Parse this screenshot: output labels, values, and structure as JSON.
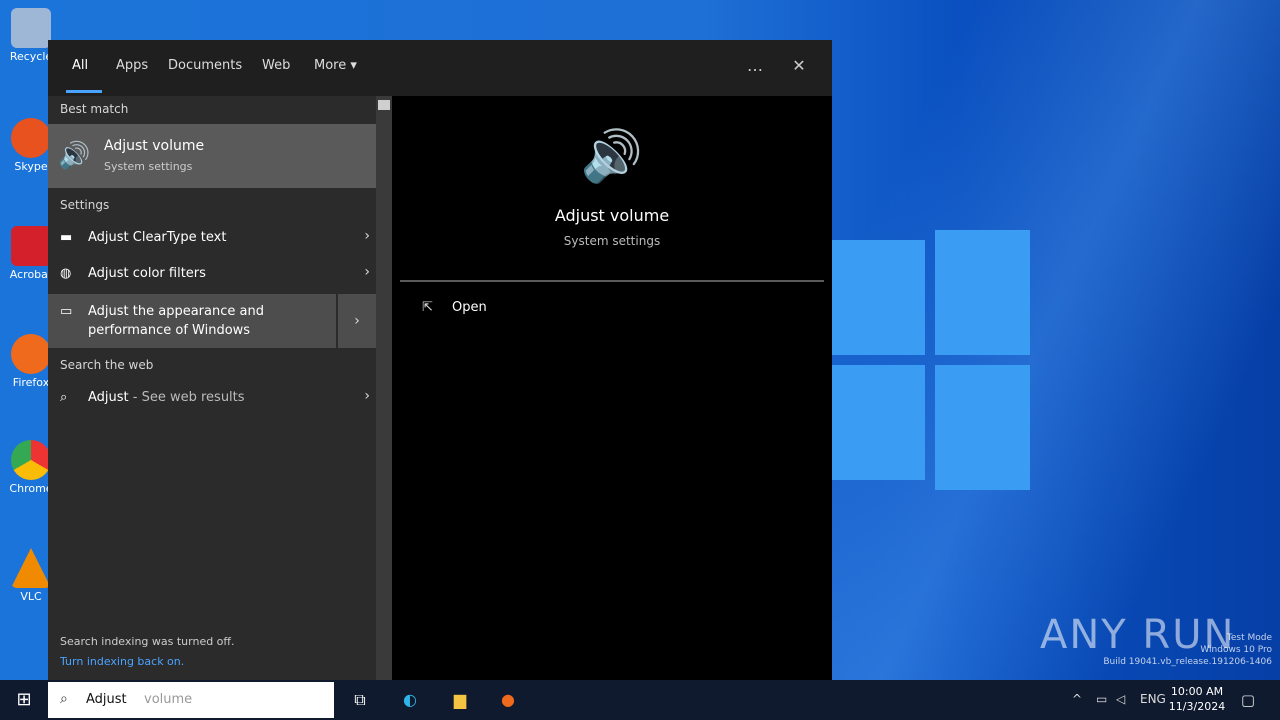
{
  "desktop": {
    "icons": [
      {
        "label": "Recycle",
        "icon": "recycle-bin-icon"
      },
      {
        "label": "Skype",
        "icon": "skype-icon"
      },
      {
        "label": "Acrobat",
        "icon": "acrobat-icon"
      },
      {
        "label": "Firefox",
        "icon": "firefox-icon"
      },
      {
        "label": "Chrome",
        "icon": "chrome-icon"
      },
      {
        "label": "VLC",
        "icon": "vlc-icon"
      }
    ],
    "watermark": "ANY RUN",
    "watermark_sub": "Test Mode\nWindows 10 Pro\nBuild 19041.vb_release.191206-1406"
  },
  "search_panel": {
    "tabs": [
      "All",
      "Apps",
      "Documents",
      "Web",
      "More ▾"
    ],
    "active_tab": "All",
    "window_controls": {
      "more": "…",
      "close": "✕"
    },
    "left": {
      "best_match_heading": "Best match",
      "best_match": {
        "title": "Adjust volume",
        "subtitle": "System settings",
        "icon": "speaker-icon"
      },
      "settings_heading": "Settings",
      "settings_items": [
        {
          "label": "Adjust ClearType text",
          "icon": "cleartype-icon"
        },
        {
          "label": "Adjust color filters",
          "icon": "color-filter-icon"
        },
        {
          "label": "Adjust the appearance and performance of Windows",
          "icon": "monitor-icon"
        }
      ],
      "web_heading": "Search the web",
      "web_item": {
        "term": "Adjust",
        "suffix": " - See web results",
        "icon": "search-icon"
      },
      "footer": "Search indexing was turned off.",
      "footer_link": "Turn indexing back on."
    },
    "right": {
      "icon": "speaker-icon",
      "title": "Adjust volume",
      "subtitle": "System settings",
      "actions": [
        {
          "label": "Open",
          "icon": "open-icon"
        }
      ]
    }
  },
  "taskbar": {
    "search_text": "Adjust",
    "search_ghost": "volume",
    "time": "10:00 AM",
    "date": "11/3/2024",
    "tray_lang": "ENG"
  }
}
